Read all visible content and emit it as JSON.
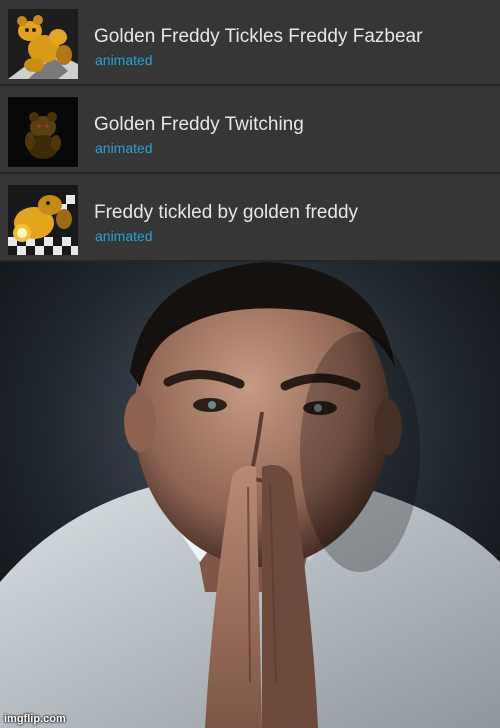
{
  "results": [
    {
      "title": "Golden Freddy Tickles Freddy Fazbear",
      "tag": "animated",
      "thumbnail_icon": "golden-freddy-bears-thumbnail"
    },
    {
      "title": "Golden Freddy Twitching",
      "tag": "animated",
      "thumbnail_icon": "dark-golden-freddy-thumbnail"
    },
    {
      "title": "Freddy tickled by golden freddy",
      "tag": "animated",
      "thumbnail_icon": "freddy-checkered-floor-thumbnail"
    }
  ],
  "colors": {
    "title_text": "#e6e6e6",
    "tag_text": "#2b9fd6",
    "row_background": "#363636"
  },
  "photo": {
    "subject": "praying-hands-man-photo"
  },
  "watermark": "imgflip.com"
}
